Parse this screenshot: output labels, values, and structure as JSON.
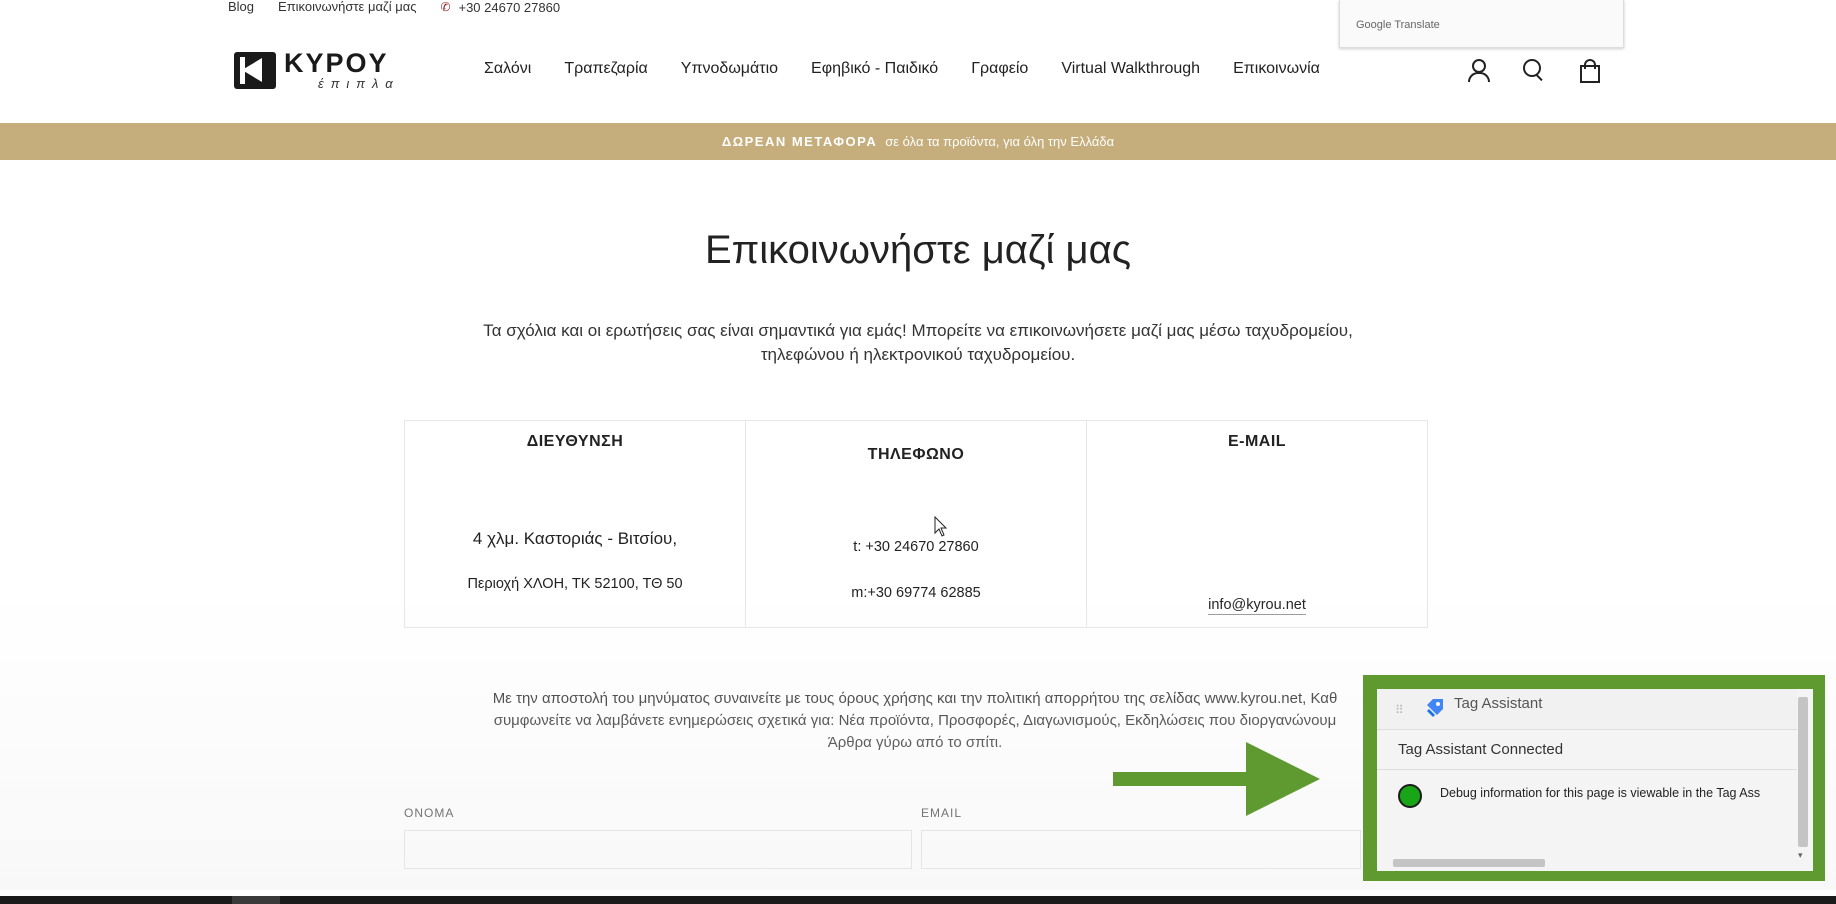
{
  "utility_bar": {
    "blog": "Blog",
    "contact": "Επικοινωνήστε μαζί μας",
    "phone": "+30 24670 27860"
  },
  "google_translate": {
    "label": "Google Translate"
  },
  "logo": {
    "name": "KYPOY",
    "sub": "έπιπλα"
  },
  "nav": {
    "items": [
      "Σαλόνι",
      "Τραπεζαρία",
      "Υπνοδωμάτιο",
      "Εφηβικό - Παιδικό",
      "Γραφείο",
      "Virtual Walkthrough",
      "Επικοινωνία"
    ]
  },
  "announcement": {
    "bold": "ΔΩΡΕΑΝ ΜΕΤΑΦΟΡΑ",
    "text": "σε όλα τα προϊόντα, για όλη την Ελλάδα"
  },
  "page": {
    "title": "Επικοινωνήστε μαζί μας",
    "intro_line1": "Τα σχόλια και οι ερωτήσεις σας είναι σημαντικά για εμάς! Μπορείτε να επικοινωνήσετε μαζί μας μέσω ταχυδρομείου,",
    "intro_line2": "τηλεφώνου ή ηλεκτρονικού ταχυδρομείου."
  },
  "contact": {
    "address": {
      "heading": "ΔΙΕΥΘΥΝΣΗ",
      "line1": "4 χλμ. Καστοριάς - Βιτσίου,",
      "line2": "Περιοχή ΧΛΟΗ, ΤΚ 52100, ΤΘ 50"
    },
    "phone": {
      "heading": "ΤΗΛΕΦΩΝΟ",
      "line1": "t:  +30 24670 27860",
      "line2": "m:+30 69774 62885"
    },
    "email": {
      "heading": "E-MAIL",
      "address": "info@kyrou.net"
    }
  },
  "consent": {
    "line1": "Με την αποστολή του μηνύματος συναινείτε με τους όρους χρήσης και την πολιτική απορρήτου της σελίδας www.kyrou.net, Καθ",
    "line2": "συμφωνείτε να λαμβάνετε ενημερώσεις σχετικά για: Νέα προϊόντα, Προσφορές, Διαγωνισμούς, Εκδηλώσεις που διοργανώνουμ",
    "line3": "Άρθρα γύρω από το σπίτι."
  },
  "form": {
    "name_label": "ΟΝΟΜΑ",
    "email_label": "EMAIL"
  },
  "tag_assistant": {
    "title": "Tag Assistant",
    "status": "Tag Assistant Connected",
    "debug": "Debug information for this page is viewable in the Tag Ass",
    "dot_color": "#18a518",
    "frame_color": "#5f9a31"
  },
  "colors": {
    "announcement_bg": "#c5ae7c",
    "highlight_green": "#5f9a31"
  }
}
